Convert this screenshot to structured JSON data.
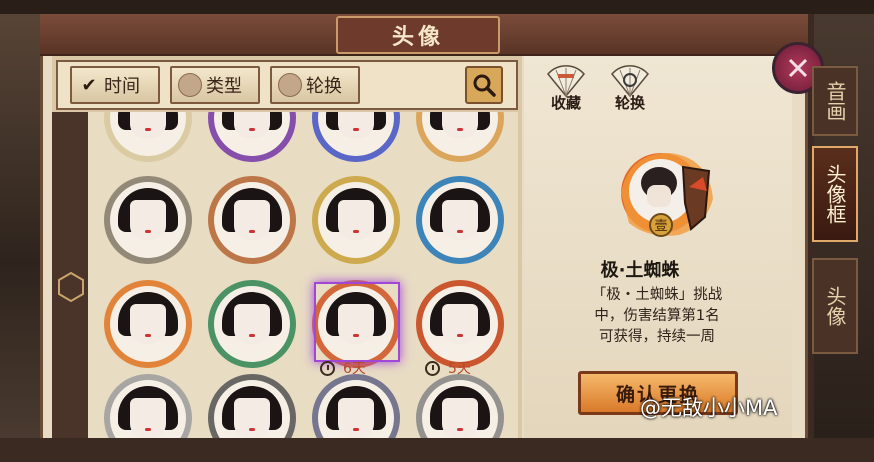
{
  "window": {
    "title": "头像"
  },
  "filters": {
    "tabs": [
      {
        "label": "时间",
        "active": true
      },
      {
        "label": "类型",
        "active": false
      },
      {
        "label": "轮换",
        "active": false
      }
    ],
    "search_icon": "magnifier-icon"
  },
  "grid": {
    "avatars": [
      {
        "frame_color": "#d8c9a0",
        "timer": null
      },
      {
        "frame_color": "#7a3fa8",
        "timer": null
      },
      {
        "frame_color": "#4a5ac8",
        "timer": null
      },
      {
        "frame_color": "#d9a050",
        "timer": null
      },
      {
        "frame_color": "#8a8070",
        "timer": null
      },
      {
        "frame_color": "#b86a3a",
        "timer": null
      },
      {
        "frame_color": "#c9a440",
        "timer": null
      },
      {
        "frame_color": "#2a7ab8",
        "timer": null
      },
      {
        "frame_color": "#e07a2a",
        "timer": null
      },
      {
        "frame_color": "#3a8a5a",
        "timer": null
      },
      {
        "frame_color": "#d05a2a",
        "timer": "6天",
        "selected": true
      },
      {
        "frame_color": "#c8481e",
        "timer": "5天"
      },
      {
        "frame_color": "#a0a0a0",
        "timer": null
      },
      {
        "frame_color": "#5a5a5a",
        "timer": null
      },
      {
        "frame_color": "#6a6a8a",
        "timer": null
      },
      {
        "frame_color": "#8a8a8a",
        "timer": null
      }
    ]
  },
  "detail": {
    "actions": [
      {
        "label": "收藏",
        "icon": "fan-icon"
      },
      {
        "label": "轮换",
        "icon": "fan-icon"
      }
    ],
    "item_name": "极·土蜘蛛",
    "description_lines": [
      "「极・土蜘蛛」挑战",
      "中，伤害结算第1名",
      "可获得，持续一周"
    ],
    "confirm_label": "确认更换",
    "badge_text": "壹"
  },
  "side_tabs": [
    {
      "label": "音画",
      "active": false
    },
    {
      "label": "头像框",
      "active": true
    },
    {
      "label": "头像",
      "active": false
    }
  ],
  "watermark": "@无敌小小MA",
  "colors": {
    "accent": "#d97a2a",
    "selected": "#a047d8",
    "timer": "#b64a2a"
  }
}
